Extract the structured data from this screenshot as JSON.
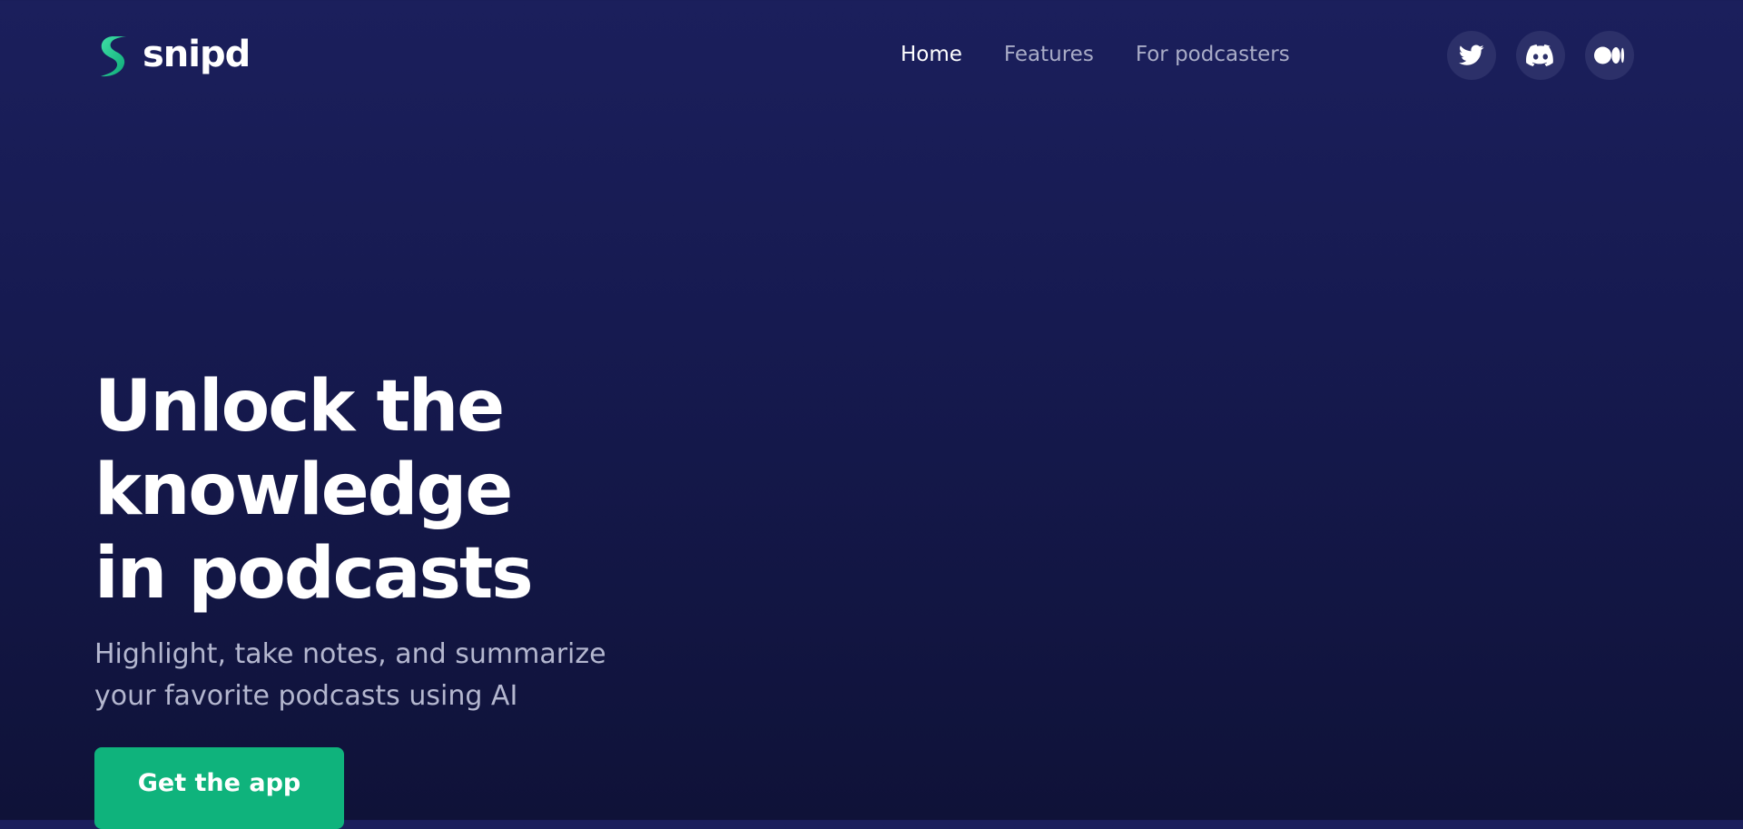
{
  "brand": {
    "name": "snipd",
    "accent_color": "#0fb37c",
    "logo_icon": "snipd-logo-icon"
  },
  "nav": {
    "items": [
      {
        "label": "Home",
        "active": true
      },
      {
        "label": "Features",
        "active": false
      },
      {
        "label": "For podcasters",
        "active": false
      }
    ]
  },
  "socials": [
    {
      "icon": "twitter-icon"
    },
    {
      "icon": "discord-icon"
    },
    {
      "icon": "medium-icon"
    }
  ],
  "hero": {
    "title_lines": [
      "Unlock the",
      "knowledge",
      "in podcasts"
    ],
    "subtitle_lines": [
      "Highlight, take notes, and summarize",
      "your favorite podcasts using AI"
    ],
    "cta_label": "Get the app"
  },
  "colors": {
    "background_top": "#1b1f5c",
    "background_bottom": "#0f1238",
    "social_button_bg": "#2c3069",
    "nav_inactive": "#a9acc7"
  }
}
